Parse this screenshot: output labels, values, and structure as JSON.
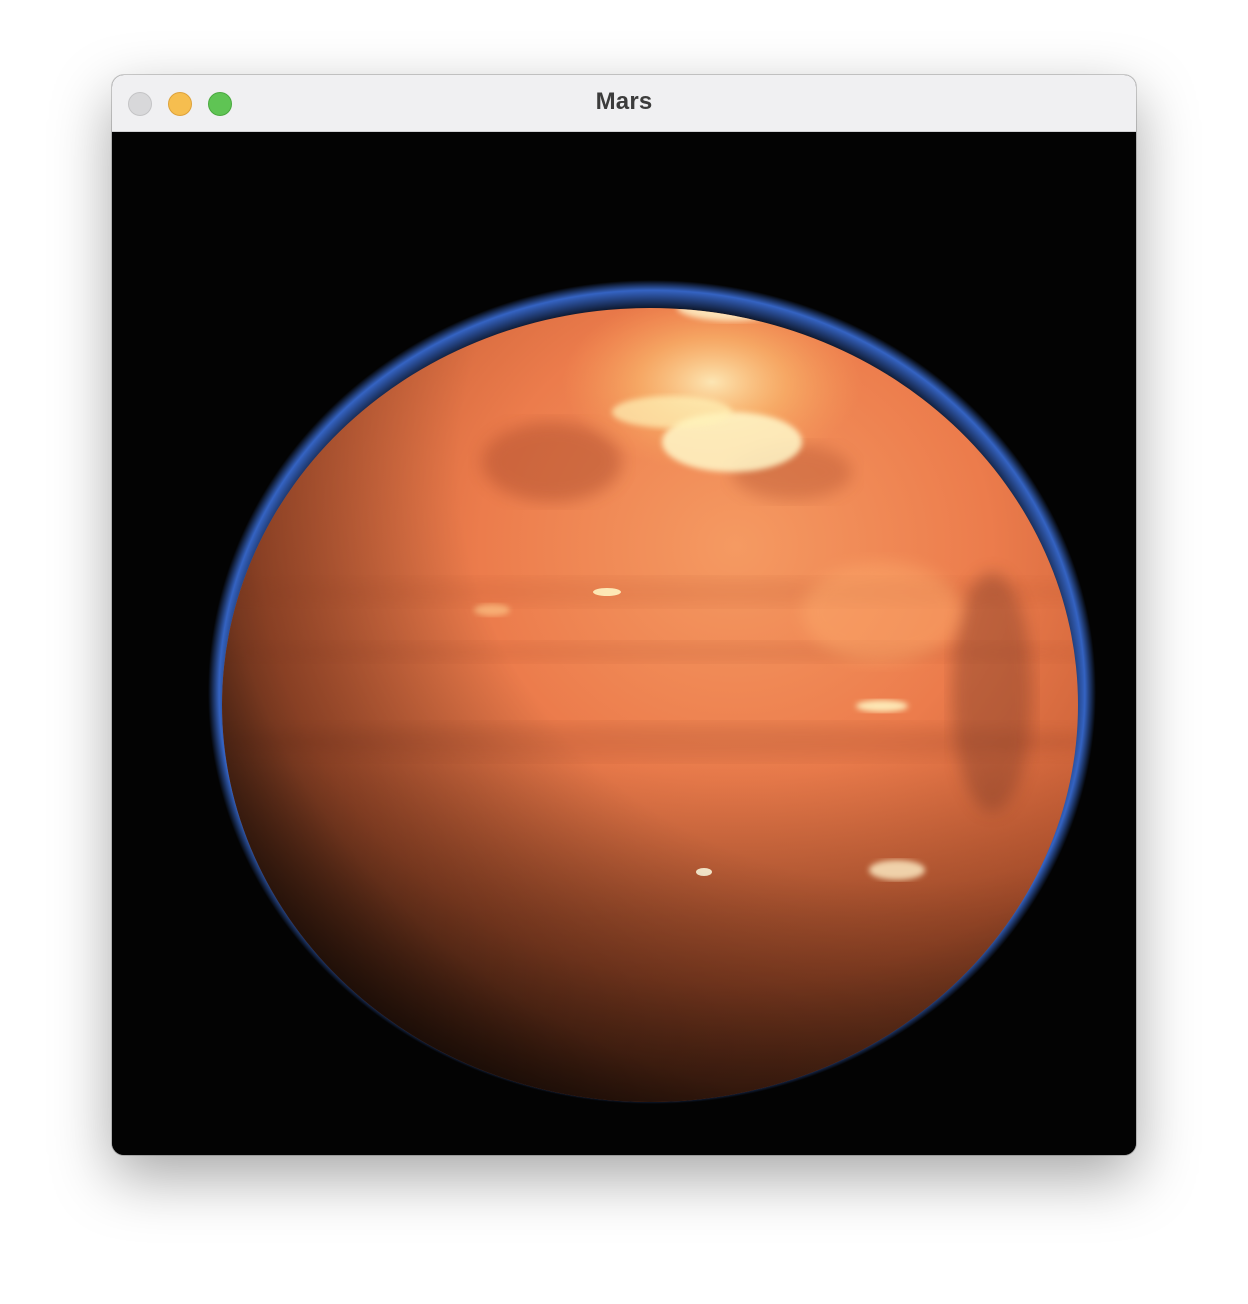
{
  "window": {
    "title": "Mars",
    "controls": {
      "close": "close-button",
      "minimize": "minimize-button",
      "maximize": "maximize-button"
    }
  },
  "image": {
    "subject": "planet-mars",
    "colors": {
      "background": "#030303",
      "planet_light": "#f08a5a",
      "planet_mid": "#e07040",
      "planet_dark": "#5a2e1a",
      "atmosphere_rim": "#3a6ed8",
      "highlight": "#fff2b0"
    }
  }
}
